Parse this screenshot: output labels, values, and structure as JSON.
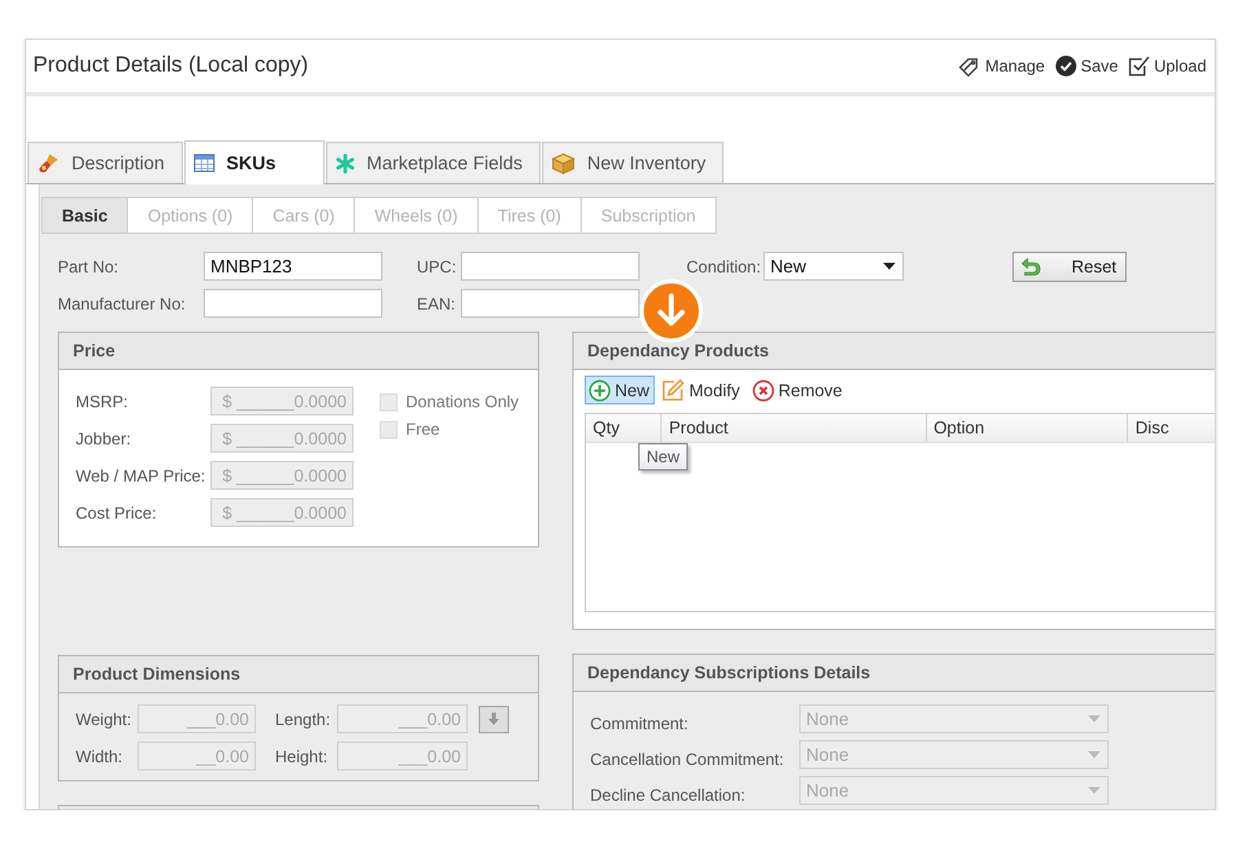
{
  "window": {
    "title": "Product Details (Local copy)"
  },
  "toolbar": [
    {
      "kind": "manage",
      "label": "Manage"
    },
    {
      "kind": "save",
      "label": "Save"
    },
    {
      "kind": "upload",
      "label": "Upload"
    }
  ],
  "tabs": [
    {
      "kind": "description",
      "label": "Description",
      "selected": false
    },
    {
      "kind": "skus",
      "label": "SKUs",
      "selected": true
    },
    {
      "kind": "marketplace",
      "label": "Marketplace Fields",
      "selected": false
    },
    {
      "kind": "inventory",
      "label": "New Inventory",
      "selected": false
    }
  ],
  "subtabs": [
    {
      "label": "Basic",
      "selected": true,
      "disabled": false
    },
    {
      "label": "Options (0)",
      "selected": false,
      "disabled": true
    },
    {
      "label": "Cars (0)",
      "selected": false,
      "disabled": true
    },
    {
      "label": "Wheels (0)",
      "selected": false,
      "disabled": true
    },
    {
      "label": "Tires (0)",
      "selected": false,
      "disabled": true
    },
    {
      "label": "Subscription",
      "selected": false,
      "disabled": true
    }
  ],
  "form_rows": [
    [
      {
        "kind": "text",
        "label": "Part No:",
        "value": "MNBP123"
      },
      {
        "kind": "text",
        "label": "UPC:"
      },
      {
        "kind": "select",
        "label": "Condition:",
        "value": "New"
      },
      {
        "kind": "button",
        "label": "Reset"
      }
    ],
    [
      {
        "kind": "text",
        "label": "Manufacturer No:"
      },
      {
        "kind": "text",
        "label": "EAN:"
      }
    ]
  ],
  "price": {
    "title": "Price",
    "rows": [
      {
        "label": "MSRP:",
        "value": "$ ______0.0000",
        "disabled": true
      },
      {
        "label": "Jobber:",
        "value": "$ ______0.0000",
        "disabled": true
      },
      {
        "label": "Web / MAP Price:",
        "value": "$ ______0.0000",
        "disabled": true
      },
      {
        "label": "Cost Price:",
        "value": "$ ______0.0000",
        "disabled": true
      }
    ],
    "checkboxes": [
      {
        "label": "Donations Only",
        "checked": false,
        "disabled": true
      },
      {
        "label": "Free",
        "checked": false,
        "disabled": true
      }
    ]
  },
  "dependancy_products": {
    "title": "Dependancy Products",
    "actions": [
      {
        "kind": "new",
        "label": "New",
        "hovered": true
      },
      {
        "kind": "modify",
        "label": "Modify",
        "hovered": false
      },
      {
        "kind": "remove",
        "label": "Remove",
        "hovered": false
      }
    ],
    "columns": [
      "Qty",
      "Product",
      "Option",
      "Disc"
    ],
    "tooltip": "New"
  },
  "product_dimensions": {
    "title": "Product Dimensions",
    "rows": [
      [
        {
          "label": "Weight:",
          "value": "___0.00",
          "disabled": true
        },
        {
          "label": "Length:",
          "value": "___0.00",
          "disabled": true
        }
      ],
      [
        {
          "label": "Width:",
          "value": "__0.00",
          "disabled": true
        },
        {
          "label": "Height:",
          "value": "___0.00",
          "disabled": true
        }
      ]
    ]
  },
  "subscriptions": {
    "title": "Dependancy Subscriptions Details",
    "rows": [
      {
        "label": "Commitment:",
        "value": "None",
        "disabled": true
      },
      {
        "label": "Cancellation Commitment:",
        "value": "None",
        "disabled": true
      },
      {
        "label": "Decline Cancellation:",
        "value": "None",
        "disabled": true
      }
    ]
  }
}
